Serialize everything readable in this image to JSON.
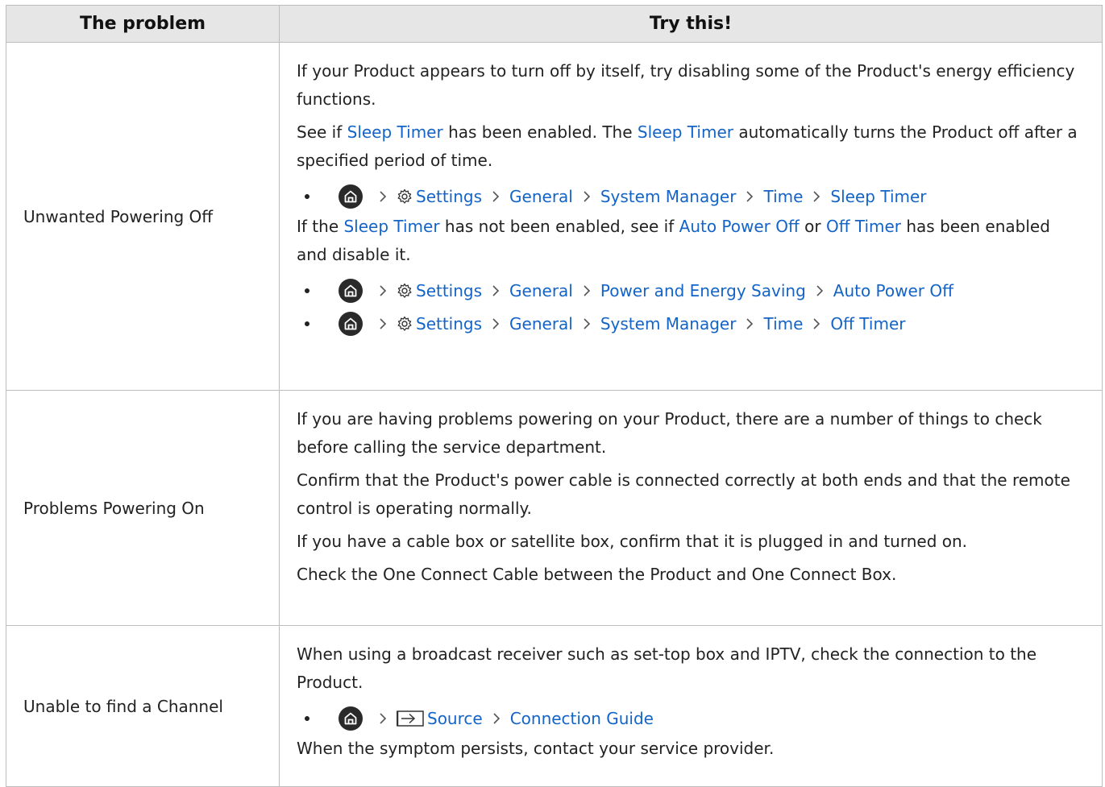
{
  "header": {
    "problem": "The problem",
    "try": "Try this!"
  },
  "rows": [
    {
      "problem": "Unwanted Powering Off",
      "p1": "If your Product appears to turn off by itself, try disabling some of the Product's energy efficiency functions.",
      "p2": {
        "a": "See if ",
        "b": "Sleep Timer",
        "c": " has been enabled. The ",
        "d": "Sleep Timer",
        "e": " automatically turns the Product off after a specified period of time."
      },
      "path1": [
        "Settings",
        "General",
        "System Manager",
        "Time",
        "Sleep Timer"
      ],
      "p3": {
        "a": "If the ",
        "b": "Sleep Timer",
        "c": " has not been enabled, see if ",
        "d": "Auto Power Off",
        "e": " or ",
        "f": "Off Timer",
        "g": " has been enabled and disable it."
      },
      "path2": [
        "Settings",
        "General",
        "Power and Energy Saving",
        "Auto Power Off"
      ],
      "path3": [
        "Settings",
        "General",
        "System Manager",
        "Time",
        "Off Timer"
      ]
    },
    {
      "problem": "Problems Powering On",
      "p1": "If you are having problems powering on your Product, there are a number of things to check before calling the service department.",
      "p2": "Confirm that the Product's power cable is connected correctly at both ends and that the remote control is operating normally.",
      "p3": "If you have a cable box or satellite box, confirm that it is plugged in and turned on.",
      "p4": "Check the One Connect Cable between the Product and One Connect Box."
    },
    {
      "problem": "Unable to find a Channel",
      "p1": "When using a broadcast receiver such as set-top box and IPTV, check the connection to the Product.",
      "path1": [
        "Source",
        "Connection Guide"
      ],
      "p2": "When the symptom persists, contact your service provider."
    }
  ],
  "colors": {
    "link": "#1464c8",
    "home_icon_bg": "#2a2a2a",
    "header_bg": "#e6e6e6",
    "border": "#bdbdbd"
  },
  "icons": {
    "home": "home-icon",
    "settings": "gear-icon",
    "source": "source-input-icon",
    "separator": "chevron-right-icon"
  }
}
